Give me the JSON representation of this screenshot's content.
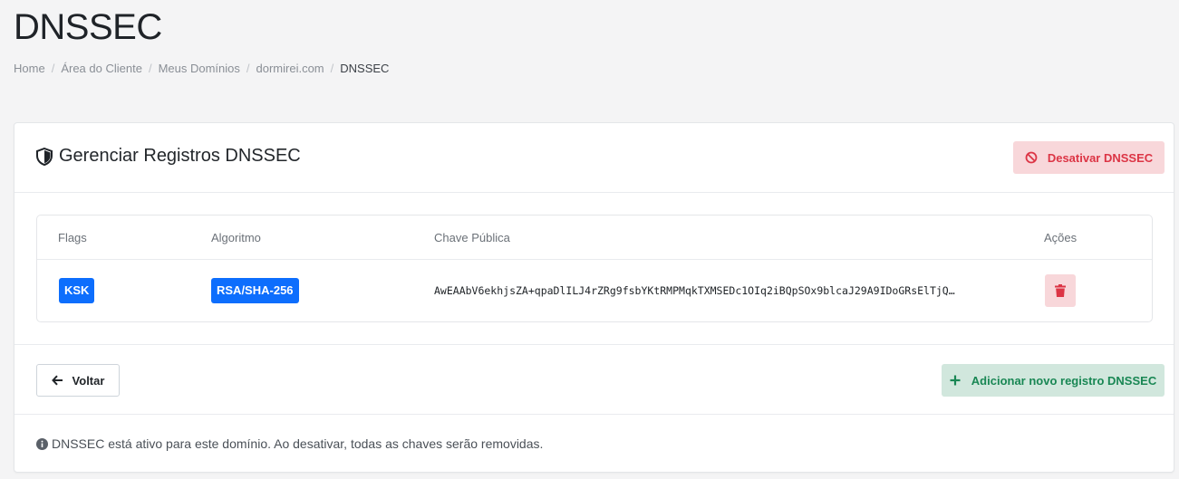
{
  "page": {
    "title": "DNSSEC"
  },
  "breadcrumb": [
    {
      "label": "Home"
    },
    {
      "label": "Área do Cliente"
    },
    {
      "label": "Meus Domínios"
    },
    {
      "label": "dormirei.com"
    },
    {
      "label": "DNSSEC"
    }
  ],
  "card": {
    "title": "Gerenciar Registros DNSSEC",
    "disable_button": "Desativar DNSSEC"
  },
  "table": {
    "headers": {
      "flags": "Flags",
      "algorithm": "Algoritmo",
      "public_key": "Chave Pública",
      "actions": "Ações"
    },
    "rows": [
      {
        "flags": "KSK",
        "algorithm": "RSA/SHA-256",
        "public_key": "AwEAAbV6ekhjsZA+qpaDlILJ4rZRg9fsbYKtRMPMqkTXMSEDc1OIq2iBQpSOx9blcaJ29A9IDoGRsElTjQ…"
      }
    ]
  },
  "actions": {
    "back_button": "Voltar",
    "add_button": "Adicionar novo registro DNSSEC"
  },
  "footer": {
    "note": "DNSSEC está ativo para este domínio. Ao desativar, todas as chaves serão removidas."
  },
  "colors": {
    "primary": "#0d6efd",
    "danger": "#dc3545",
    "danger_bg": "#f8d7da",
    "success": "#198754",
    "success_bg": "#d1e7dd"
  }
}
